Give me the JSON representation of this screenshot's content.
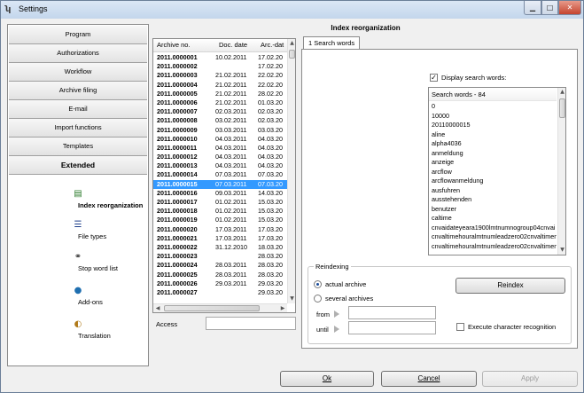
{
  "window": {
    "title": "Settings"
  },
  "nav": {
    "buttons": [
      "Program",
      "Authorizations",
      "Workflow",
      "Archive filing",
      "E-mail",
      "Import functions",
      "Templates",
      "Extended"
    ],
    "subitems": [
      {
        "label": "Index reorganization",
        "icon": "index-reorganization-icon"
      },
      {
        "label": "File types",
        "icon": "file-types-icon"
      },
      {
        "label": "Stop word list",
        "icon": "stop-word-list-icon"
      },
      {
        "label": "Add-ons",
        "icon": "add-ons-icon"
      },
      {
        "label": "Translation",
        "icon": "translation-icon"
      }
    ]
  },
  "panel": {
    "title": "Index reorganization"
  },
  "archive_list": {
    "columns": [
      "Archive no.",
      "Doc. date",
      "Arc.-dat"
    ],
    "rows": [
      [
        "2011.0000001",
        "10.02.2011",
        "17.02.20"
      ],
      [
        "2011.0000002",
        "",
        "17.02.20"
      ],
      [
        "2011.0000003",
        "21.02.2011",
        "22.02.20"
      ],
      [
        "2011.0000004",
        "21.02.2011",
        "22.02.20"
      ],
      [
        "2011.0000005",
        "21.02.2011",
        "28.02.20"
      ],
      [
        "2011.0000006",
        "21.02.2011",
        "01.03.20"
      ],
      [
        "2011.0000007",
        "02.03.2011",
        "02.03.20"
      ],
      [
        "2011.0000008",
        "03.02.2011",
        "02.03.20"
      ],
      [
        "2011.0000009",
        "03.03.2011",
        "03.03.20"
      ],
      [
        "2011.0000010",
        "04.03.2011",
        "04.03.20"
      ],
      [
        "2011.0000011",
        "04.03.2011",
        "04.03.20"
      ],
      [
        "2011.0000012",
        "04.03.2011",
        "04.03.20"
      ],
      [
        "2011.0000013",
        "04.03.2011",
        "04.03.20"
      ],
      [
        "2011.0000014",
        "07.03.2011",
        "07.03.20"
      ],
      [
        "2011.0000015",
        "07.03.2011",
        "07.03.20"
      ],
      [
        "2011.0000016",
        "09.03.2011",
        "14.03.20"
      ],
      [
        "2011.0000017",
        "01.02.2011",
        "15.03.20"
      ],
      [
        "2011.0000018",
        "01.02.2011",
        "15.03.20"
      ],
      [
        "2011.0000019",
        "01.02.2011",
        "15.03.20"
      ],
      [
        "2011.0000020",
        "17.03.2011",
        "17.03.20"
      ],
      [
        "2011.0000021",
        "17.03.2011",
        "17.03.20"
      ],
      [
        "2011.0000022",
        "31.12.2010",
        "18.03.20"
      ],
      [
        "2011.0000023",
        "",
        "28.03.20"
      ],
      [
        "2011.0000024",
        "28.03.2011",
        "28.03.20"
      ],
      [
        "2011.0000025",
        "28.03.2011",
        "28.03.20"
      ],
      [
        "2011.0000026",
        "29.03.2011",
        "29.03.20"
      ],
      [
        "2011.0000027",
        "",
        "29.03.20"
      ]
    ],
    "selected_index": 14
  },
  "access": {
    "label": "Access",
    "value": ""
  },
  "tab": {
    "label": "1 Search words"
  },
  "search": {
    "display_label": "Display search words:",
    "display_checked": true,
    "header": "Search words - 84",
    "words": [
      "0",
      "10000",
      "20110000015",
      "aline",
      "alpha4036",
      "anmeldung",
      "anzeige",
      "arcflow",
      "arcflowanmeldung",
      "ausfuhren",
      "ausstehenden",
      "benutzer",
      "caltime",
      "cnvaidateyeara1900lmtnumnogroup04cnvai",
      "cnvaltimehouralmtnumleadzero02cnvaltimen",
      "cnvaltimehouralmtnumleadzero02cnvaltimen"
    ]
  },
  "reindexing": {
    "legend": "Reindexing",
    "actual_archive": "actual archive",
    "several_archives": "several archives",
    "from_label": "from",
    "until_label": "until",
    "from_value": "",
    "until_value": "",
    "reindex_button": "Reindex",
    "ocr_label": "Execute character recognition",
    "ocr_checked": false
  },
  "footer": {
    "ok": "Ok",
    "cancel": "Cancel",
    "apply": "Apply"
  }
}
